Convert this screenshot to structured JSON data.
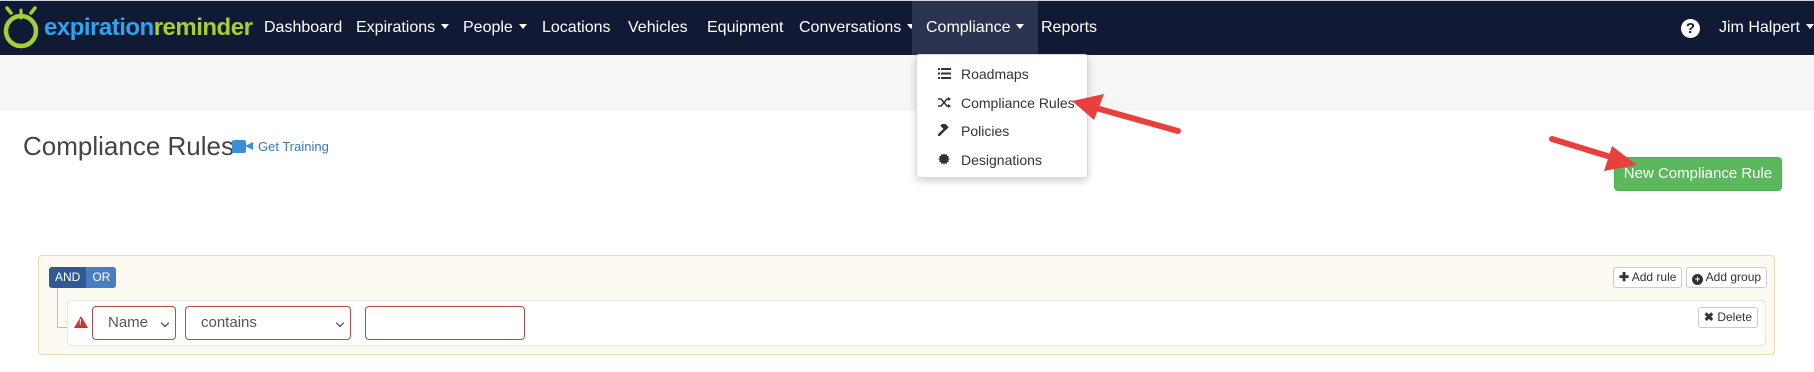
{
  "brand": {
    "part1": "expiration",
    "part2": "reminder",
    "color_blue": "#2ea3f2",
    "color_green": "#a6cf37"
  },
  "navbar": {
    "background": "#111a35",
    "items": [
      {
        "label": "Dashboard",
        "dropdown": false
      },
      {
        "label": "Expirations",
        "dropdown": true
      },
      {
        "label": "People",
        "dropdown": true
      },
      {
        "label": "Locations",
        "dropdown": false
      },
      {
        "label": "Vehicles",
        "dropdown": false
      },
      {
        "label": "Equipment",
        "dropdown": false
      },
      {
        "label": "Conversations",
        "dropdown": true
      },
      {
        "label": "Compliance",
        "dropdown": true,
        "active": true
      },
      {
        "label": "Reports",
        "dropdown": false
      }
    ],
    "help_label": "?",
    "user_name": "Jim Halpert"
  },
  "compliance_menu": {
    "items": [
      {
        "label": "Roadmaps",
        "icon": "list-icon"
      },
      {
        "label": "Compliance Rules",
        "icon": "shuffle-icon"
      },
      {
        "label": "Policies",
        "icon": "gavel-icon"
      },
      {
        "label": "Designations",
        "icon": "badge-icon"
      }
    ]
  },
  "page": {
    "title": "Compliance Rules",
    "training_link": "Get Training",
    "new_button": "New Compliance Rule",
    "new_button_color": "#5cb85c"
  },
  "query_builder": {
    "and_label": "AND",
    "or_label": "OR",
    "add_rule_label": "Add rule",
    "add_group_label": "Add group",
    "rule": {
      "field": "Name",
      "operator": "contains",
      "value": "",
      "delete_label": "Delete"
    }
  },
  "annotation_color": "#e8413d"
}
